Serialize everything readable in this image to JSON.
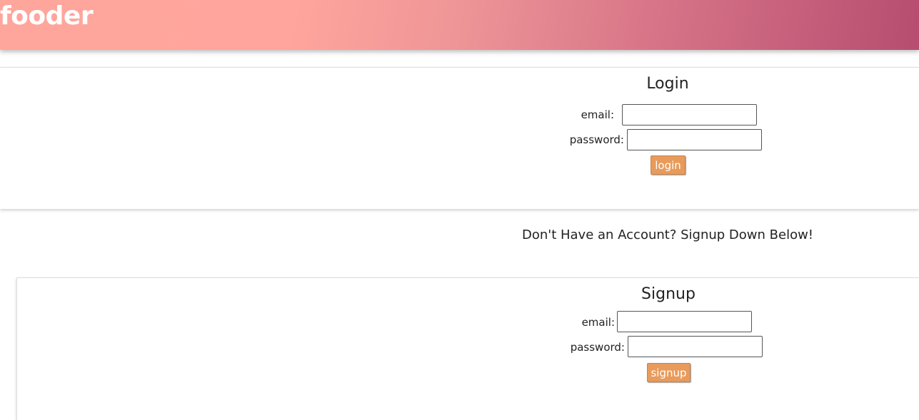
{
  "header": {
    "brand": "fooder"
  },
  "login": {
    "title": "Login",
    "email_label": "email:",
    "password_label": "password:",
    "email_value": "",
    "password_value": "",
    "button_label": "login"
  },
  "signup_prompt": "Don't Have an Account? Signup Down Below!",
  "signup": {
    "title": "Signup",
    "email_label": "email:",
    "password_label": "password:",
    "email_value": "",
    "password_value": "",
    "button_label": "signup"
  },
  "colors": {
    "header_gradient_start": "#ffa69c",
    "header_gradient_end": "#b64d70",
    "button": "#e89b5b"
  }
}
